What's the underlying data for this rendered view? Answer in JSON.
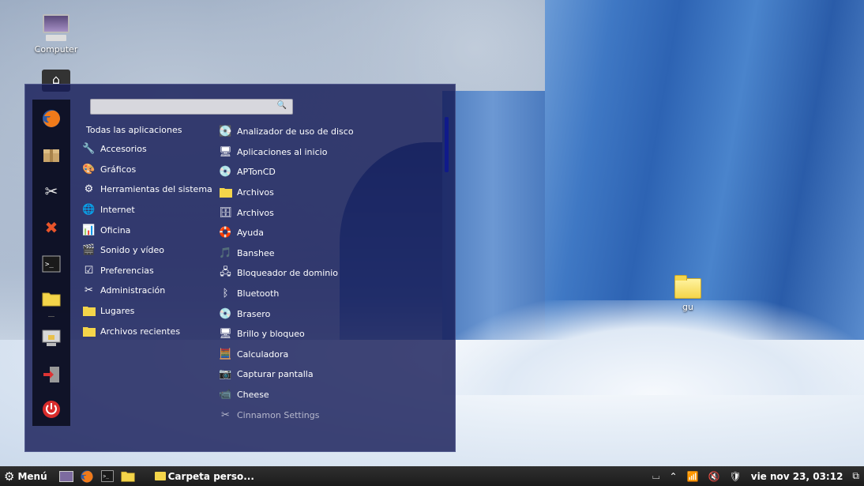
{
  "desktop": {
    "icons": [
      {
        "label": "Computer",
        "icon": "computer-icon"
      },
      {
        "label": "",
        "icon": "home-folder-icon"
      },
      {
        "label": "gu",
        "icon": "folder-icon"
      }
    ]
  },
  "menu": {
    "search": {
      "value": "",
      "placeholder": ""
    },
    "favorites": [
      "firefox-icon",
      "package-installer-icon",
      "tools-icon",
      "close-icon",
      "terminal-icon",
      "folder-icon",
      "lock-screen-icon",
      "logout-icon",
      "power-icon"
    ],
    "categories_header": "Todas las aplicaciones",
    "categories": [
      {
        "label": "Accesorios",
        "icon": "accessories-icon"
      },
      {
        "label": "Gráficos",
        "icon": "graphics-icon"
      },
      {
        "label": "Herramientas del sistema",
        "icon": "system-tools-icon"
      },
      {
        "label": "Internet",
        "icon": "internet-icon"
      },
      {
        "label": "Oficina",
        "icon": "office-icon"
      },
      {
        "label": "Sonido y vídeo",
        "icon": "multimedia-icon"
      },
      {
        "label": "Preferencias",
        "icon": "preferences-icon"
      },
      {
        "label": "Administración",
        "icon": "administration-icon"
      },
      {
        "label": "Lugares",
        "icon": "folder-icon"
      },
      {
        "label": "Archivos recientes",
        "icon": "folder-icon"
      }
    ],
    "apps": [
      {
        "label": "Analizador de uso de disco",
        "icon": "disk-usage-icon"
      },
      {
        "label": "Aplicaciones al inicio",
        "icon": "startup-apps-icon"
      },
      {
        "label": "APTonCD",
        "icon": "aptoncd-icon"
      },
      {
        "label": "Archivos",
        "icon": "folder-icon"
      },
      {
        "label": "Archivos",
        "icon": "archive-icon"
      },
      {
        "label": "Ayuda",
        "icon": "help-icon"
      },
      {
        "label": "Banshee",
        "icon": "banshee-icon"
      },
      {
        "label": "Bloqueador de dominio",
        "icon": "domain-blocker-icon"
      },
      {
        "label": "Bluetooth",
        "icon": "bluetooth-icon"
      },
      {
        "label": "Brasero",
        "icon": "brasero-icon"
      },
      {
        "label": "Brillo y bloqueo",
        "icon": "brightness-lock-icon"
      },
      {
        "label": "Calculadora",
        "icon": "calculator-icon"
      },
      {
        "label": "Capturar pantalla",
        "icon": "screenshot-icon"
      },
      {
        "label": "Cheese",
        "icon": "cheese-icon"
      },
      {
        "label": "Cinnamon Settings",
        "icon": "settings-icon"
      }
    ]
  },
  "panel": {
    "menu_label": "Menú",
    "launchers": [
      "show-desktop-icon",
      "firefox-icon",
      "terminal-icon",
      "folder-icon"
    ],
    "window_title": "Carpeta perso...",
    "clock": "vie nov 23, 03:12"
  }
}
